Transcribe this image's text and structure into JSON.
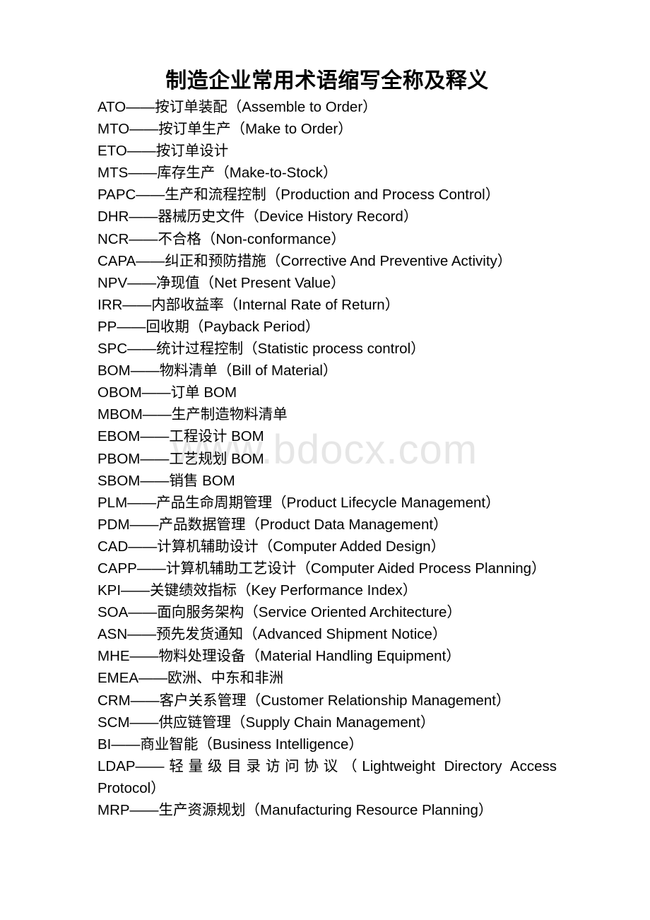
{
  "document": {
    "title": "制造企业常用术语缩写全称及释义",
    "watermark": "www.bdocx.com",
    "terms": [
      {
        "line": "ATO——按订单装配（Assemble to Order）"
      },
      {
        "line": "MTO——按订单生产（Make to Order）"
      },
      {
        "line": "ETO——按订单设计"
      },
      {
        "line": "MTS——库存生产（Make-to-Stock）"
      },
      {
        "line": "PAPC——生产和流程控制（Production and Process Control）"
      },
      {
        "line": "DHR——器械历史文件（Device History Record）"
      },
      {
        "line": "NCR——不合格（Non-conformance）"
      },
      {
        "line": "CAPA——纠正和预防措施（Corrective And Preventive Activity）"
      },
      {
        "line": "NPV——净现值（Net Present Value）"
      },
      {
        "line": "IRR——内部收益率（Internal Rate of Return）"
      },
      {
        "line": "PP——回收期（Payback Period）"
      },
      {
        "line": "SPC——统计过程控制（Statistic process control）"
      },
      {
        "line": "BOM——物料清单（Bill of Material）"
      },
      {
        "line": "OBOM——订单 BOM"
      },
      {
        "line": "MBOM——生产制造物料清单"
      },
      {
        "line": "EBOM——工程设计 BOM"
      },
      {
        "line": "PBOM——工艺规划 BOM"
      },
      {
        "line": "SBOM——销售 BOM"
      },
      {
        "line": "PLM——产品生命周期管理（Product Lifecycle Management）"
      },
      {
        "line": "PDM——产品数据管理（Product Data Management）"
      },
      {
        "line": "CAD——计算机辅助设计（Computer Added Design）"
      },
      {
        "line": "CAPP——计算机辅助工艺设计（Computer Aided Process Planning）"
      },
      {
        "line": "KPI——关键绩效指标（Key Performance Index）"
      },
      {
        "line": "SOA——面向服务架构（Service Oriented Architecture）"
      },
      {
        "line": "ASN——预先发货通知（Advanced Shipment Notice）"
      },
      {
        "line": "MHE——物料处理设备（Material Handling Equipment）"
      },
      {
        "line": "EMEA——欧洲、中东和非洲"
      },
      {
        "line": "CRM——客户关系管理（Customer Relationship Management）"
      },
      {
        "line": "SCM——供应链管理（Supply Chain Management）"
      },
      {
        "line": "BI——商业智能（Business Intelligence）"
      },
      {
        "line": "LDAP——轻量级目录访问协议（Lightweight Directory Access Protocol）",
        "wrap": true
      },
      {
        "line": "MRP——生产资源规划（Manufacturing Resource Planning）"
      }
    ]
  }
}
